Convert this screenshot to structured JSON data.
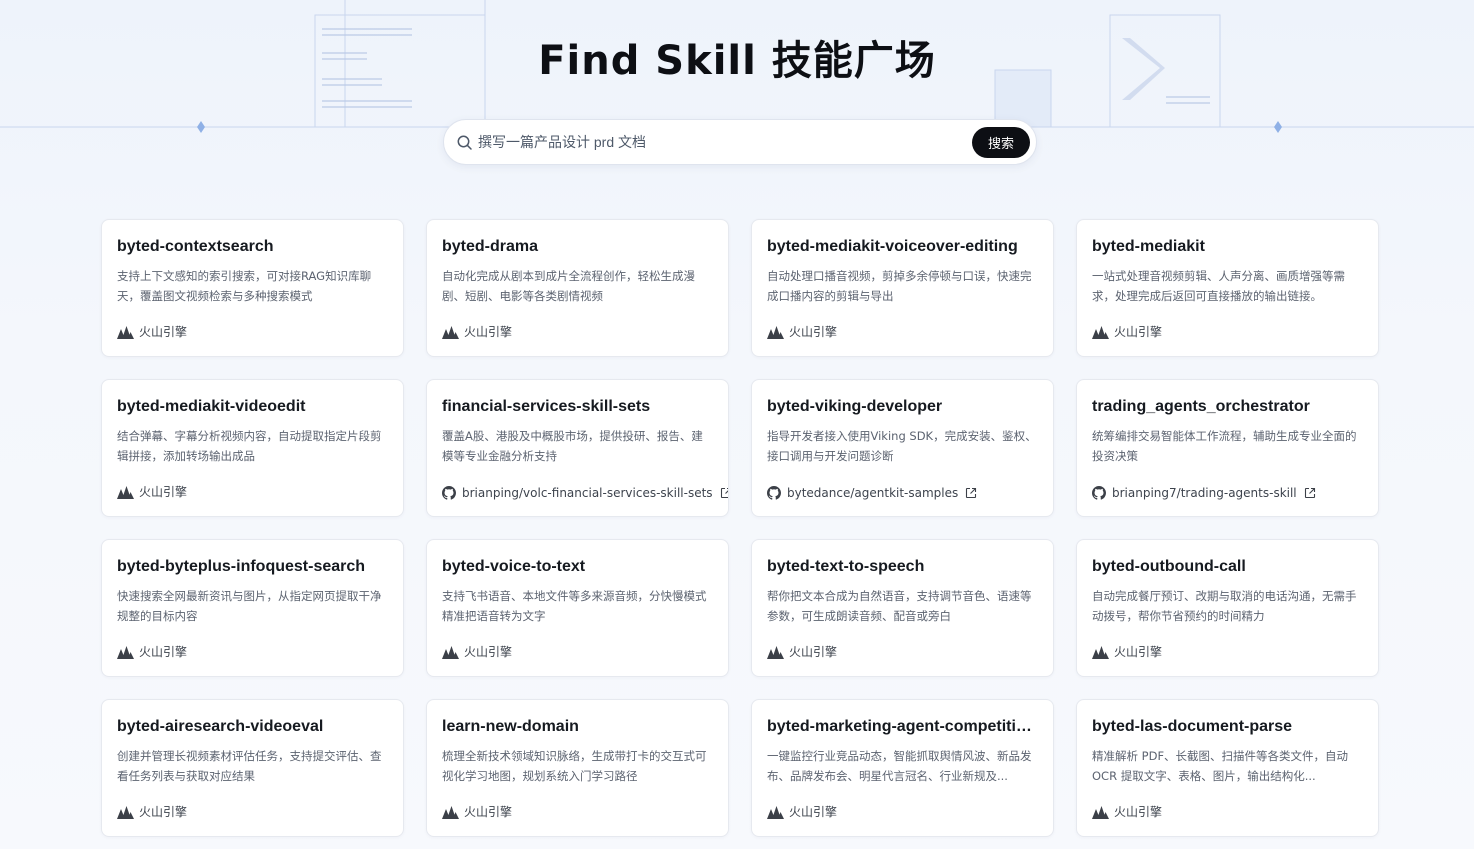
{
  "header": {
    "title": "Find Skill  技能广场"
  },
  "search": {
    "placeholder": "撰写一篇产品设计 prd 文档",
    "button_label": "搜索"
  },
  "cards": [
    {
      "title": "byted-contextsearch",
      "desc": "支持上下文感知的索引搜索，可对接RAG知识库聊天，覆盖图文视频检索与多种搜索模式",
      "source": "火山引擎",
      "source_type": "volc-logo"
    },
    {
      "title": "byted-drama",
      "desc": "自动化完成从剧本到成片全流程创作，轻松生成漫剧、短剧、电影等各类剧情视频",
      "source": "火山引擎",
      "source_type": "volc-logo"
    },
    {
      "title": "byted-mediakit-voiceover-editing",
      "desc": "自动处理口播音视频，剪掉多余停顿与口误，快速完成口播内容的剪辑与导出",
      "source": "火山引擎",
      "source_type": "volc-logo"
    },
    {
      "title": "byted-mediakit",
      "desc": "一站式处理音视频剪辑、人声分离、画质增强等需求，处理完成后返回可直接播放的输出链接。",
      "source": "火山引擎",
      "source_type": "volc-logo"
    },
    {
      "title": "byted-mediakit-videoedit",
      "desc": "结合弹幕、字幕分析视频内容，自动提取指定片段剪辑拼接，添加转场输出成品",
      "source": "火山引擎",
      "source_type": "volc-logo"
    },
    {
      "title": "financial-services-skill-sets",
      "desc": "覆盖A股、港股及中概股市场，提供投研、报告、建模等专业金融分析支持",
      "source": "brianping/volc-financial-services-skill-sets",
      "source_type": "github"
    },
    {
      "title": "byted-viking-developer",
      "desc": "指导开发者接入使用Viking SDK，完成安装、鉴权、接口调用与开发问题诊断",
      "source": "bytedance/agentkit-samples",
      "source_type": "github"
    },
    {
      "title": "trading_agents_orchestrator",
      "desc": "统筹编排交易智能体工作流程，辅助生成专业全面的投资决策",
      "source": "brianping7/trading-agents-skill",
      "source_type": "github"
    },
    {
      "title": "byted-byteplus-infoquest-search",
      "desc": "快速搜索全网最新资讯与图片，从指定网页提取干净规整的目标内容",
      "source": "火山引擎",
      "source_type": "volc-logo"
    },
    {
      "title": "byted-voice-to-text",
      "desc": "支持飞书语音、本地文件等多来源音频，分快慢模式精准把语音转为文字",
      "source": "火山引擎",
      "source_type": "volc-logo"
    },
    {
      "title": "byted-text-to-speech",
      "desc": "帮你把文本合成为自然语音，支持调节音色、语速等参数，可生成朗读音频、配音或旁白",
      "source": "火山引擎",
      "source_type": "volc-logo"
    },
    {
      "title": "byted-outbound-call",
      "desc": "自动完成餐厅预订、改期与取消的电话沟通，无需手动拨号，帮你节省预约的时间精力",
      "source": "火山引擎",
      "source_type": "volc-logo"
    },
    {
      "title": "byted-airesearch-videoeval",
      "desc": "创建并管理长视频素材评估任务，支持提交评估、查看任务列表与获取对应结果",
      "source": "火山引擎",
      "source_type": "volc-logo"
    },
    {
      "title": "learn-new-domain",
      "desc": "梳理全新技术领域知识脉络，生成带打卡的交互式可视化学习地图，规划系统入门学习路径",
      "source": "火山引擎",
      "source_type": "volc-logo"
    },
    {
      "title": "byted-marketing-agent-competitive-...",
      "desc": "一键监控行业竞品动态，智能抓取舆情风波、新品发布、品牌发布会、明星代言冠名、行业新规及...",
      "source": "火山引擎",
      "source_type": "volc-logo"
    },
    {
      "title": "byted-las-document-parse",
      "desc": "精准解析 PDF、长截图、扫描件等各类文件，自动 OCR 提取文字、表格、图片，输出结构化...",
      "source": "火山引擎",
      "source_type": "volc-logo"
    }
  ]
}
